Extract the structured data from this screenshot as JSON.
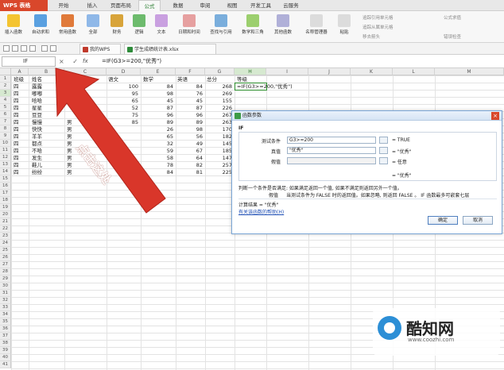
{
  "app": {
    "name": "WPS 表格"
  },
  "menu": {
    "tabs": [
      "开始",
      "插入",
      "页面布局",
      "公式",
      "数据",
      "审阅",
      "视图",
      "开发工具",
      "云服务"
    ],
    "active": "公式"
  },
  "ribbon": {
    "buttons": [
      "插入函数",
      "自动求和",
      "常用函数",
      "全部",
      "财务",
      "逻辑",
      "文本",
      "日期和时间",
      "查找与引用",
      "数学和三角",
      "其他函数",
      "名称管理器",
      "粘贴"
    ],
    "side": [
      "追踪引用单元格",
      "追踪从属单元格",
      "移去箭头",
      "公式求值",
      "错误检查"
    ]
  },
  "toolbar": {
    "tabs": [
      "我的WPS",
      "学生成绩统计表.xlsx"
    ]
  },
  "formula_bar": {
    "name_box": "IF",
    "fx": "fx",
    "formula": "=IF(G3>=200,\"优秀\")"
  },
  "sheet": {
    "columns": [
      "A",
      "B",
      "C",
      "D",
      "E",
      "F",
      "G",
      "H",
      "I",
      "J",
      "K",
      "L",
      "M"
    ],
    "headers": [
      "班级",
      "姓名",
      "性别",
      "语文",
      "数学",
      "英语",
      "总分",
      "等级"
    ],
    "rows": [
      [
        "四",
        "露露",
        "",
        "100",
        "84",
        "84",
        "268",
        "=IF(G3>=200,\"优秀\")"
      ],
      [
        "四",
        "嘟嘟",
        "",
        "95",
        "98",
        "76",
        "269",
        ""
      ],
      [
        "四",
        "哈哈",
        "",
        "65",
        "45",
        "45",
        "155",
        ""
      ],
      [
        "四",
        "星星",
        "",
        "52",
        "87",
        "87",
        "226",
        ""
      ],
      [
        "四",
        "豆豆",
        "",
        "75",
        "96",
        "96",
        "267",
        ""
      ],
      [
        "四",
        "慢慢",
        "男",
        "85",
        "89",
        "89",
        "263",
        ""
      ],
      [
        "四",
        "快快",
        "男",
        "",
        "26",
        "98",
        "170",
        ""
      ],
      [
        "四",
        "羊羊",
        "男",
        "",
        "65",
        "56",
        "182",
        ""
      ],
      [
        "四",
        "都点",
        "男",
        "",
        "32",
        "49",
        "145",
        ""
      ],
      [
        "四",
        "不哈",
        "男",
        "",
        "59",
        "67",
        "185",
        ""
      ],
      [
        "四",
        "发生",
        "男",
        "",
        "58",
        "64",
        "147",
        ""
      ],
      [
        "四",
        "鞋儿",
        "男",
        "97",
        "78",
        "82",
        "257",
        ""
      ],
      [
        "四",
        "纷纷",
        "男",
        "60",
        "84",
        "81",
        "225",
        ""
      ]
    ]
  },
  "annotation": {
    "text": "点击这处"
  },
  "dialog": {
    "title": "函数参数",
    "function": "IF",
    "args": [
      {
        "label": "测试条件",
        "value": "G3>=200",
        "result": "= TRUE"
      },
      {
        "label": "真值",
        "value": "\"优秀\"",
        "result": "= \"优秀\""
      },
      {
        "label": "假值",
        "value": "",
        "result": "= 任意"
      }
    ],
    "overall": "= \"优秀\"",
    "desc1": "判断一个条件是否满足: 如果满足返回一个值, 如果不满足则返回另外一个值。",
    "desc2_label": "假值",
    "desc2": "当测试条件为 FALSE 时的返回值。如果忽略, 则返回 FALSE 。 IF 函数最多可嵌套七层",
    "calc": "计算结果 = \"优秀\"",
    "link": "有关该函数的帮助(H)",
    "ok": "确定",
    "cancel": "取消"
  },
  "watermark": {
    "title": "酷知网",
    "url": "www.coozhi.com"
  }
}
